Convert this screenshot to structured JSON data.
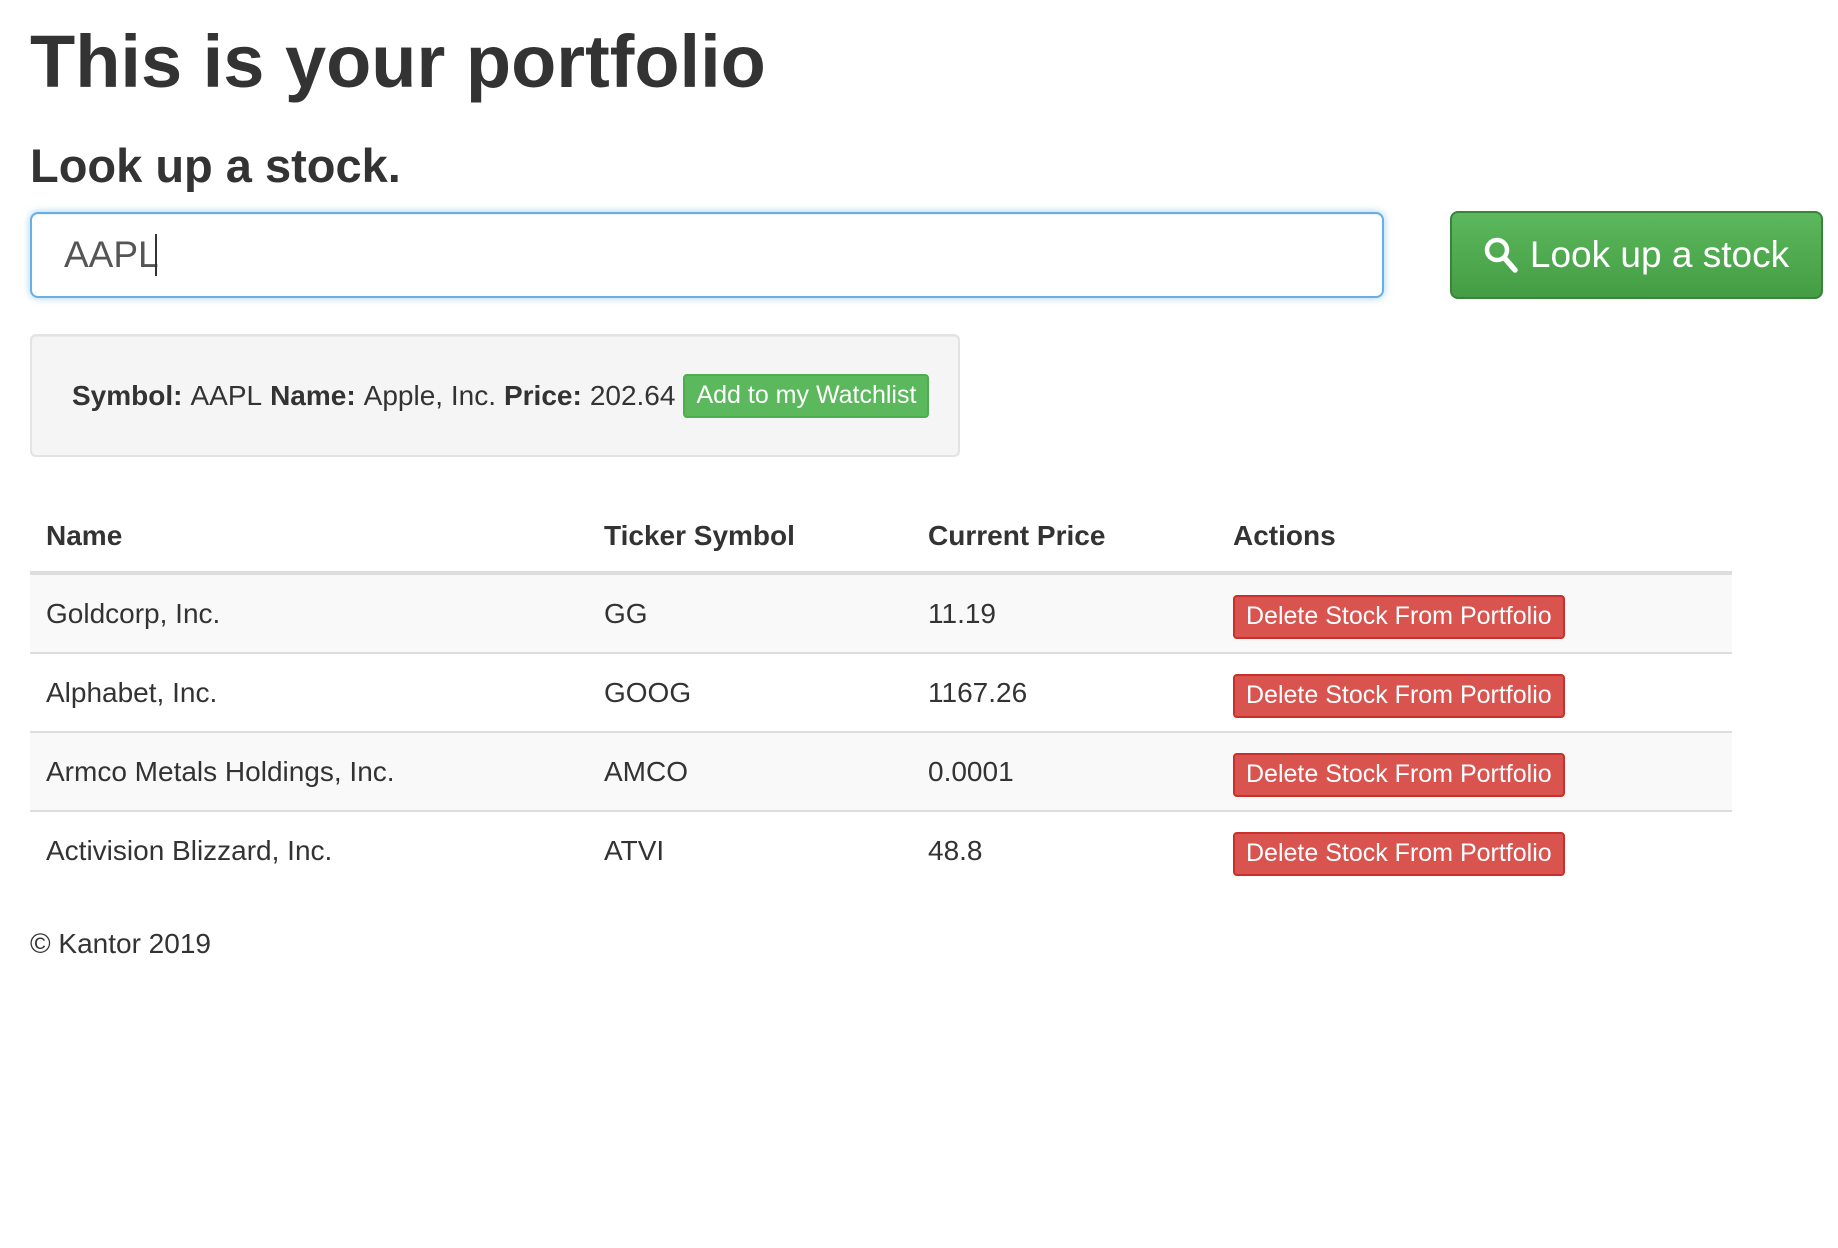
{
  "page": {
    "title": "This is your portfolio",
    "subtitle": "Look up a stock."
  },
  "search": {
    "value": "AAPL",
    "placeholder": "",
    "button_label": "Look up a stock",
    "button_icon": "search-icon"
  },
  "result": {
    "symbol_label": "Symbol:",
    "symbol_value": "AAPL",
    "name_label": "Name:",
    "name_value": "Apple, Inc.",
    "price_label": "Price:",
    "price_value": "202.64",
    "add_button_label": "Add to my Watchlist"
  },
  "table": {
    "headers": [
      "Name",
      "Ticker Symbol",
      "Current Price",
      "Actions"
    ],
    "rows": [
      {
        "name": "Goldcorp, Inc.",
        "ticker": "GG",
        "price": "11.19",
        "action": "Delete Stock From Portfolio"
      },
      {
        "name": "Alphabet, Inc.",
        "ticker": "GOOG",
        "price": "1167.26",
        "action": "Delete Stock From Portfolio"
      },
      {
        "name": "Armco Metals Holdings, Inc.",
        "ticker": "AMCO",
        "price": "0.0001",
        "action": "Delete Stock From Portfolio"
      },
      {
        "name": "Activision Blizzard, Inc.",
        "ticker": "ATVI",
        "price": "48.8",
        "action": "Delete Stock From Portfolio"
      }
    ]
  },
  "footer": {
    "text": "© Kantor 2019"
  },
  "colors": {
    "success": "#5cb85c",
    "danger": "#d9534f",
    "focus": "#66afe9",
    "text": "#333333"
  }
}
